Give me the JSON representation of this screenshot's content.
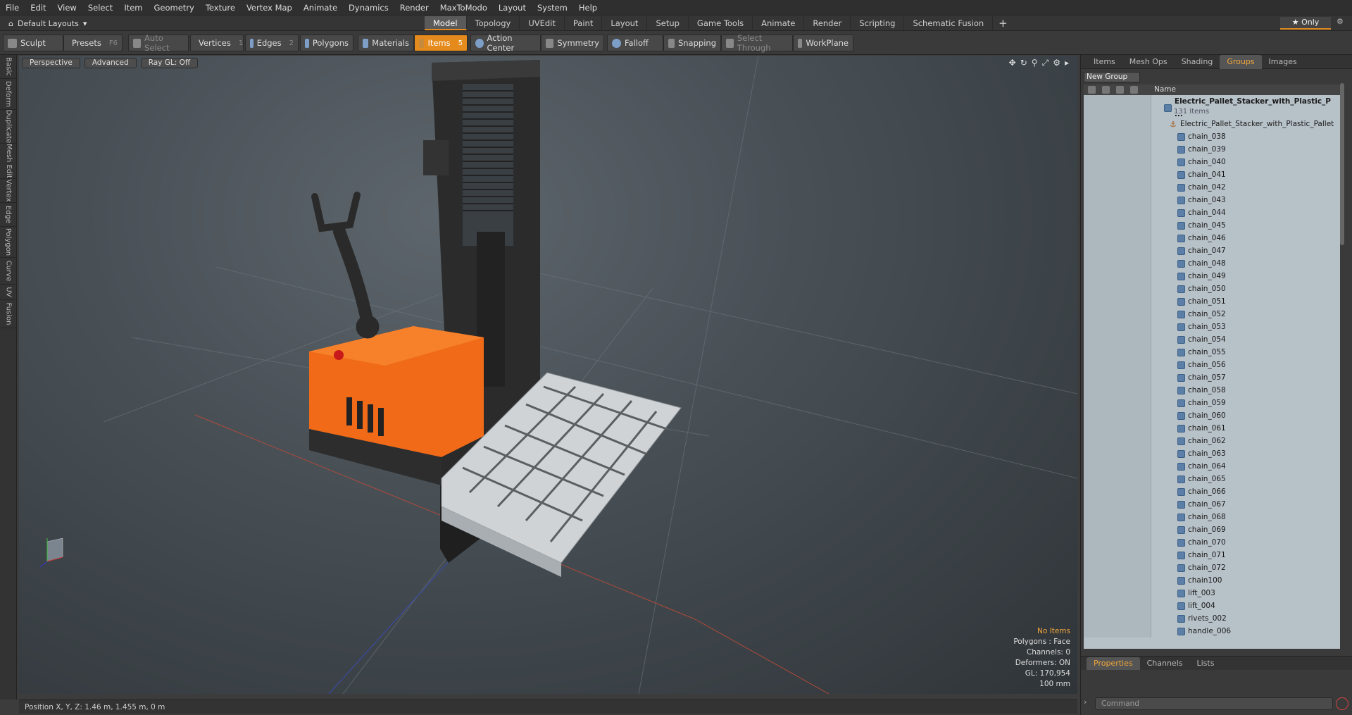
{
  "menu": [
    "File",
    "Edit",
    "View",
    "Select",
    "Item",
    "Geometry",
    "Texture",
    "Vertex Map",
    "Animate",
    "Dynamics",
    "Render",
    "MaxToModo",
    "Layout",
    "System",
    "Help"
  ],
  "layout_selector": "Default Layouts",
  "mode_tabs": [
    "Model",
    "Topology",
    "UVEdit",
    "Paint",
    "Layout",
    "Setup",
    "Game Tools",
    "Animate",
    "Render",
    "Scripting",
    "Schematic Fusion"
  ],
  "active_mode_tab": "Model",
  "only_button": "Only",
  "toolbar": {
    "sculpt": "Sculpt",
    "presets": "Presets",
    "presets_key": "F6",
    "auto_select": "Auto Select",
    "vertices": "Vertices",
    "vertices_num": "1",
    "edges": "Edges",
    "edges_num": "2",
    "polygons": "Polygons",
    "materials": "Materials",
    "items": "Items",
    "items_num": "5",
    "action_center": "Action Center",
    "symmetry": "Symmetry",
    "falloff": "Falloff",
    "snapping": "Snapping",
    "select_through": "Select Through",
    "workplane": "WorkPlane"
  },
  "left_tabs": [
    "Basic",
    "Deform",
    "Duplicate",
    "Mesh Edit",
    "Vertex",
    "Edge",
    "Polygon",
    "Curve",
    "UV",
    "Fusion"
  ],
  "viewport": {
    "view": "Perspective",
    "shading": "Advanced",
    "raygl": "Ray GL: Off",
    "info": {
      "no_items": "No Items",
      "polygons": "Polygons : Face",
      "channels": "Channels: 0",
      "deformers": "Deformers: ON",
      "gl": "GL: 170,954",
      "scale": "100 mm"
    }
  },
  "status_bar": "Position X, Y, Z:   1.46 m, 1.455 m, 0 m",
  "right_panel": {
    "tabs": [
      "Items",
      "Mesh Ops",
      "Shading",
      "Groups",
      "Images"
    ],
    "active_tab": "Groups",
    "new_group": "New Group",
    "name_header": "Name",
    "group_name": "Electric_Pallet_Stacker_with_Plastic_P ...",
    "group_count": "131 Items",
    "locator": "Electric_Pallet_Stacker_with_Plastic_Pallet",
    "items": [
      "chain_038",
      "chain_039",
      "chain_040",
      "chain_041",
      "chain_042",
      "chain_043",
      "chain_044",
      "chain_045",
      "chain_046",
      "chain_047",
      "chain_048",
      "chain_049",
      "chain_050",
      "chain_051",
      "chain_052",
      "chain_053",
      "chain_054",
      "chain_055",
      "chain_056",
      "chain_057",
      "chain_058",
      "chain_059",
      "chain_060",
      "chain_061",
      "chain_062",
      "chain_063",
      "chain_064",
      "chain_065",
      "chain_066",
      "chain_067",
      "chain_068",
      "chain_069",
      "chain_070",
      "chain_071",
      "chain_072",
      "chain100",
      "lift_003",
      "lift_004",
      "rivets_002",
      "handle_006"
    ],
    "bottom_tabs": [
      "Properties",
      "Channels",
      "Lists"
    ],
    "command_placeholder": "Command"
  }
}
